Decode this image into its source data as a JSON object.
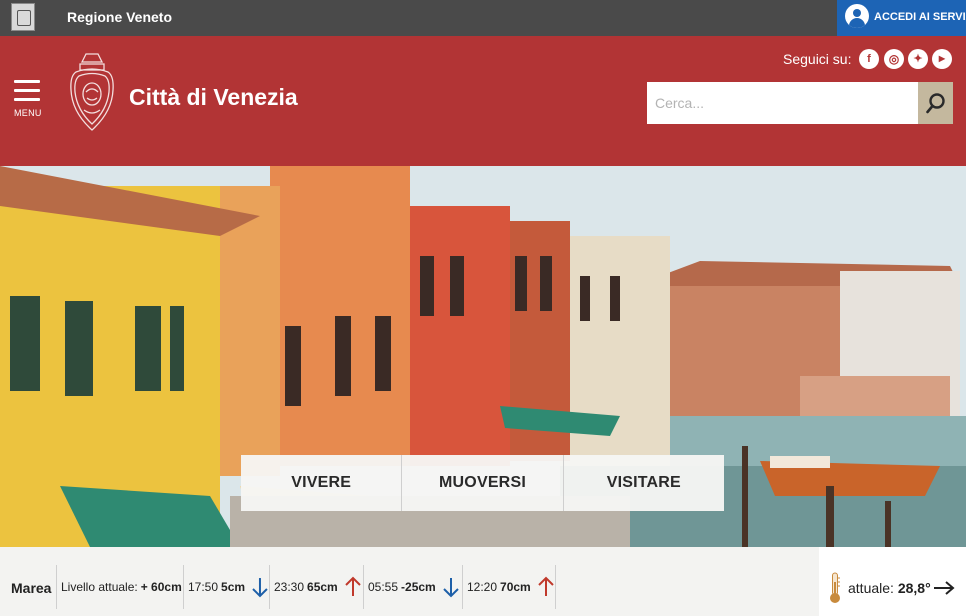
{
  "topbar": {
    "region_name": "Regione Veneto",
    "accedi_label": "ACCEDI AI SERVIZI"
  },
  "header": {
    "menu_label": "MENU",
    "city_title": "Città di Venezia",
    "follow_label": "Seguici su:",
    "social": [
      {
        "name": "facebook-icon",
        "glyph": "f"
      },
      {
        "name": "instagram-icon",
        "glyph": "◎"
      },
      {
        "name": "twitter-icon",
        "glyph": "✦"
      },
      {
        "name": "youtube-icon",
        "glyph": "▶"
      }
    ],
    "search_placeholder": "Cerca..."
  },
  "nav": {
    "items": [
      "VIVERE",
      "MUOVERSI",
      "VISITARE"
    ]
  },
  "tide": {
    "label": "Marea",
    "current_prefix": "Livello attuale:",
    "current_value": "+ 60cm",
    "forecasts": [
      {
        "time": "17:50",
        "level": "5cm",
        "direction": "down"
      },
      {
        "time": "23:30",
        "level": "65cm",
        "direction": "up"
      },
      {
        "time": "05:55",
        "level": "-25cm",
        "direction": "down"
      },
      {
        "time": "12:20",
        "level": "70cm",
        "direction": "up"
      }
    ]
  },
  "weather": {
    "prefix": "attuale:",
    "value": "28,8°"
  },
  "colors": {
    "header_red": "#b23435",
    "topbar_gray": "#4a4a4a",
    "accedi_blue": "#1d64b5",
    "arrow_down": "#1d5fa8",
    "arrow_up": "#c0392b",
    "search_button": "#c4b89e"
  }
}
